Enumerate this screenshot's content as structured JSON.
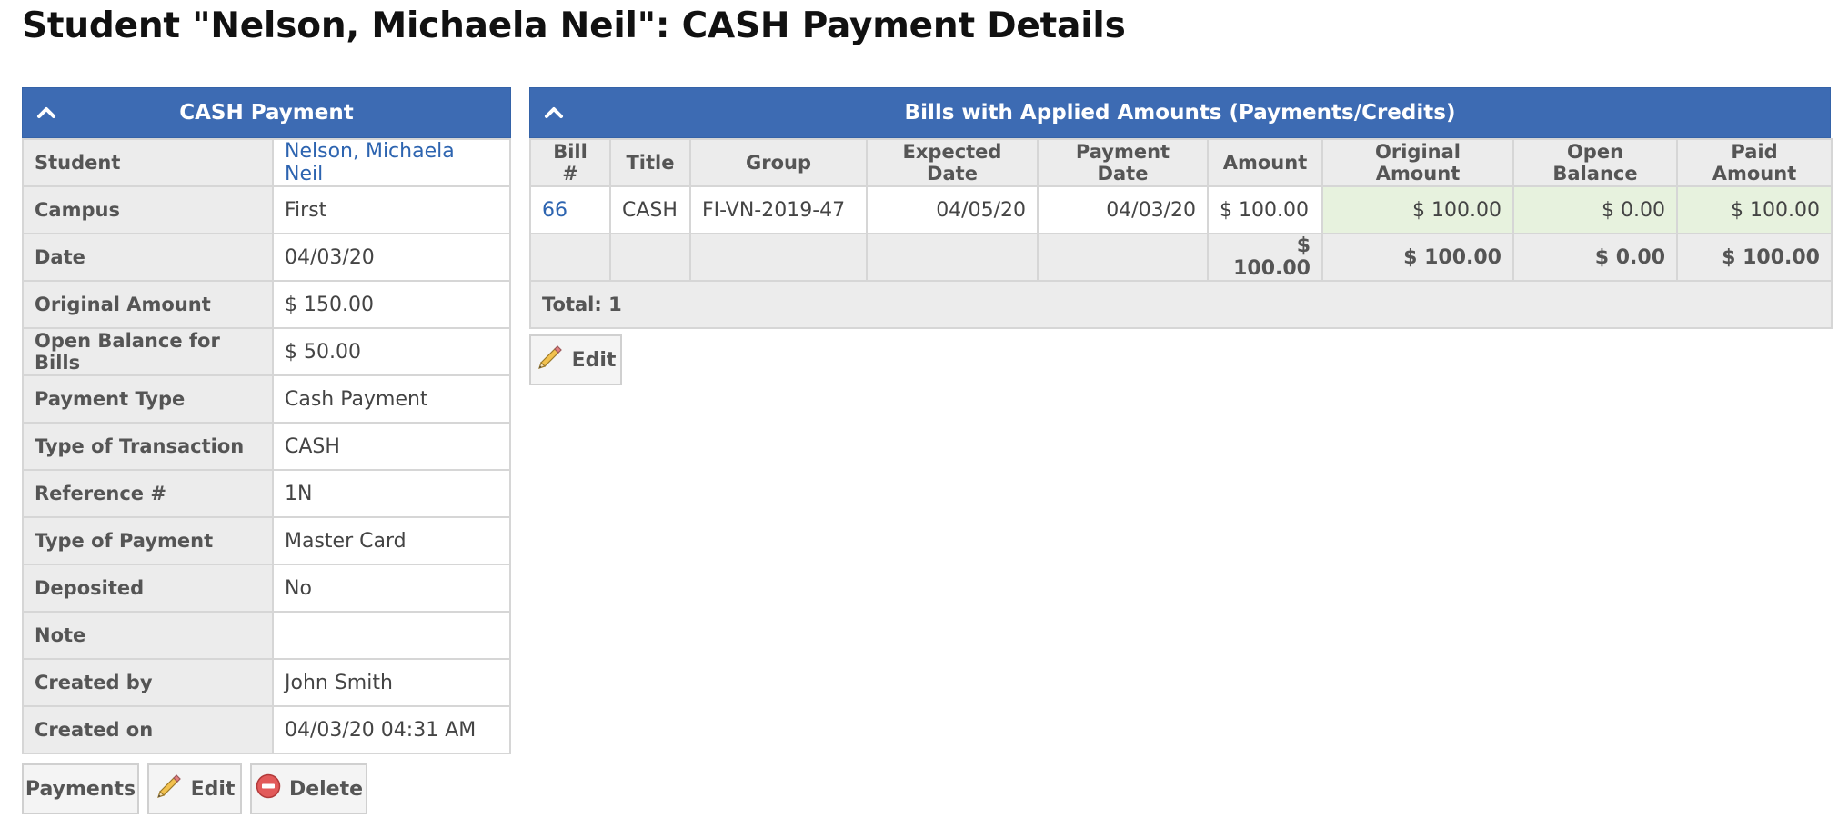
{
  "page_title": "Student \"Nelson, Michaela Neil\": CASH Payment Details",
  "payment_panel": {
    "title": "CASH Payment",
    "rows": [
      {
        "label": "Student",
        "value": "Nelson, Michaela Neil"
      },
      {
        "label": "Campus",
        "value": "First"
      },
      {
        "label": "Date",
        "value": "04/03/20"
      },
      {
        "label": "Original Amount",
        "value": "$ 150.00"
      },
      {
        "label": "Open Balance for Bills",
        "value": "$ 50.00"
      },
      {
        "label": "Payment Type",
        "value": "Cash Payment"
      },
      {
        "label": "Type of Transaction",
        "value": "CASH"
      },
      {
        "label": "Reference #",
        "value": "1N"
      },
      {
        "label": "Type of Payment",
        "value": "Master Card"
      },
      {
        "label": "Deposited",
        "value": "No"
      },
      {
        "label": "Note",
        "value": ""
      },
      {
        "label": "Created by",
        "value": "John Smith"
      },
      {
        "label": "Created on",
        "value": "04/03/20 04:31 AM"
      }
    ],
    "buttons": {
      "payments": "Payments",
      "edit": "Edit",
      "delete": "Delete"
    }
  },
  "bills_panel": {
    "title": "Bills with Applied Amounts (Payments/Credits)",
    "columns": [
      "Bill #",
      "Title",
      "Group",
      "Expected Date",
      "Payment Date",
      "Amount",
      "Original Amount",
      "Open Balance",
      "Paid Amount"
    ],
    "rows": [
      {
        "bill": "66",
        "title": "CASH",
        "group": "FI-VN-2019-47",
        "expected_date": "04/05/20",
        "payment_date": "04/03/20",
        "amount": "$ 100.00",
        "original_amount": "$ 100.00",
        "open_balance": "$ 0.00",
        "paid_amount": "$ 100.00"
      }
    ],
    "totals": {
      "amount": "$ 100.00",
      "original_amount": "$ 100.00",
      "open_balance": "$ 0.00",
      "paid_amount": "$ 100.00"
    },
    "count_text": "Total: 1",
    "edit_button": "Edit"
  },
  "colors": {
    "header_blue": "#3d6bb3",
    "link_blue": "#2d64b0",
    "paid_green_bg": "#e7f2de"
  },
  "icons": {
    "collapse": "chevron-up-icon",
    "edit": "pencil-icon",
    "delete": "minus-circle-icon"
  }
}
